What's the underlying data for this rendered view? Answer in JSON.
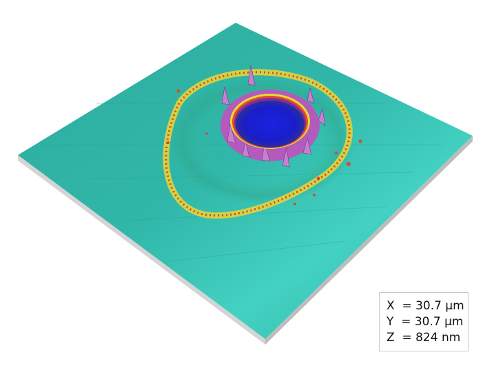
{
  "scale_box": {
    "x_line": "X  = 30.7 µm",
    "y_line": "Y  = 30.7 µm",
    "z_line": "Z  = 824 nm"
  },
  "colors": {
    "surface": "#24b3a4",
    "surface_highlight": "#3fd6c7",
    "base_edge": "#cfcfcf",
    "rim_outer_yellow": "#e6d23a",
    "rim_outer_red": "#d8452a",
    "crater_rim": "#a94fb5",
    "crater_floor": "#1a24d8"
  },
  "icons": [
    "afm-3d-surface-image"
  ]
}
